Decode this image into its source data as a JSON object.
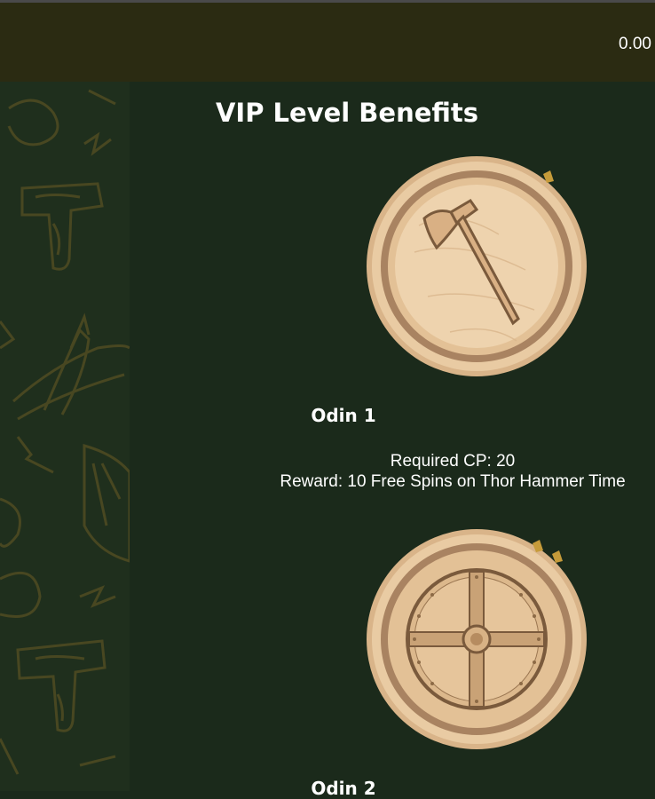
{
  "header": {
    "balance": "0.00"
  },
  "page": {
    "title": "VIP Level Benefits"
  },
  "levels": [
    {
      "name": "Odin 1",
      "required_cp": "Required CP: 20",
      "reward": "Reward: 10 Free Spins on Thor Hammer Time",
      "icon": "axe-icon"
    },
    {
      "name": "Odin 2",
      "icon": "shield-icon"
    }
  ],
  "colors": {
    "background": "#1b2a1b",
    "header": "#2b2b12",
    "sidebar": "#1f2f1d",
    "pattern": "#4d4a22",
    "coin_light": "#e8c9a0",
    "coin_dark": "#b08a60"
  }
}
